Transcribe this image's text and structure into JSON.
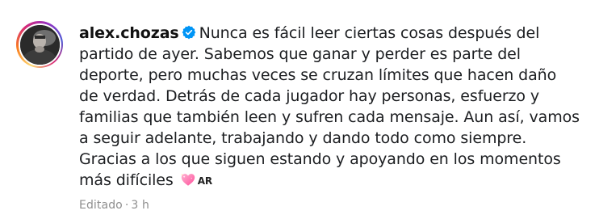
{
  "post": {
    "username": "alex.chozas",
    "caption_text": "Nunca es fácil leer ciertas cosas después del partido de ayer. Sabemos que ganar y perder es parte del deporte, pero muchas veces se cruzan límites que hacen daño de verdad. Detrás de cada jugador hay personas, esfuerzo y familias que también leen y sufren cada mensaje. Aun así, vamos a seguir adelante, trabajando y dando todo como siempre. Gracias a los que siguen estando y apoyando en los momentos más difíciles",
    "emoji_icon": "sparkling-heart-icon",
    "country_flag_label": "AR",
    "edited_label": "Editado",
    "separator": "·",
    "time_ago": "3 h",
    "verified_icon": "verified-badge-icon"
  },
  "colors": {
    "verified_blue": "#0095f6",
    "meta_gray": "#8e8e8e",
    "text": "#1c1e21",
    "heart_pink": "#ff6fae"
  }
}
